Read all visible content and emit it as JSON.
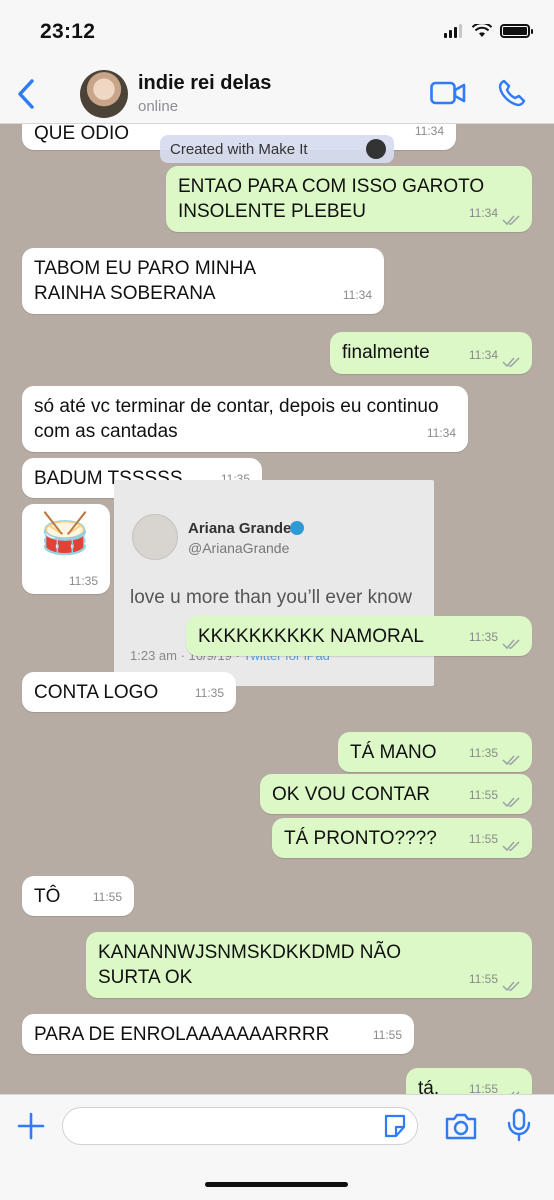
{
  "status_bar": {
    "time": "23:12"
  },
  "header": {
    "contact_name": "indie rei delas",
    "contact_status": "online"
  },
  "watermark": {
    "text": "Created with Make It"
  },
  "messages": [
    {
      "dir": "in",
      "text": "QUE ODIO",
      "time": "11:34"
    },
    {
      "dir": "out",
      "text": "ENTAO PARA COM ISSO GAROTO INSOLENTE PLEBEU",
      "time": "11:34"
    },
    {
      "dir": "in",
      "text": "TABOM EU PARO MINHA RAINHA SOBERANA",
      "time": "11:34"
    },
    {
      "dir": "out",
      "text": "finalmente",
      "time": "11:34"
    },
    {
      "dir": "in",
      "text": "só até vc terminar de contar, depois eu continuo com as cantadas",
      "time": "11:34"
    },
    {
      "dir": "in",
      "text": "BADUM TSSSSS",
      "time": "11:35"
    },
    {
      "dir": "in",
      "text": "🥁",
      "time": "11:35"
    },
    {
      "dir": "out",
      "text": "KKKKKKKKKK NAMORAL",
      "time": "11:35"
    },
    {
      "dir": "in",
      "text": "CONTA LOGO",
      "time": "11:35"
    },
    {
      "dir": "out",
      "text": "TÁ MANO",
      "time": "11:35"
    },
    {
      "dir": "out",
      "text": "OK VOU CONTAR",
      "time": "11:55"
    },
    {
      "dir": "out",
      "text": "TÁ PRONTO????",
      "time": "11:55"
    },
    {
      "dir": "in",
      "text": "TÔ",
      "time": "11:55"
    },
    {
      "dir": "out",
      "text": "KANANNWJSNMSKDKKDMD NÃO SURTA OK",
      "time": "11:55"
    },
    {
      "dir": "in",
      "text": "PARA DE ENROLAAAAAAARRRR",
      "time": "11:55"
    },
    {
      "dir": "out",
      "text": "tá.",
      "time": "11:55"
    }
  ],
  "tweet": {
    "name": "Ariana Grande",
    "handle": "@ArianaGrande",
    "text": "love u more than you’ll ever know",
    "meta_time": "1:23 am · 16/9/19 · ",
    "meta_source": "Twitter for iPad"
  },
  "composer": {
    "placeholder": ""
  },
  "colors": {
    "accent": "#2f7cf6",
    "outgoing_bubble": "#dcf8c6",
    "incoming_bubble": "#ffffff",
    "chat_background": "#b7aca3",
    "tick_color": "#9aa0a6"
  }
}
